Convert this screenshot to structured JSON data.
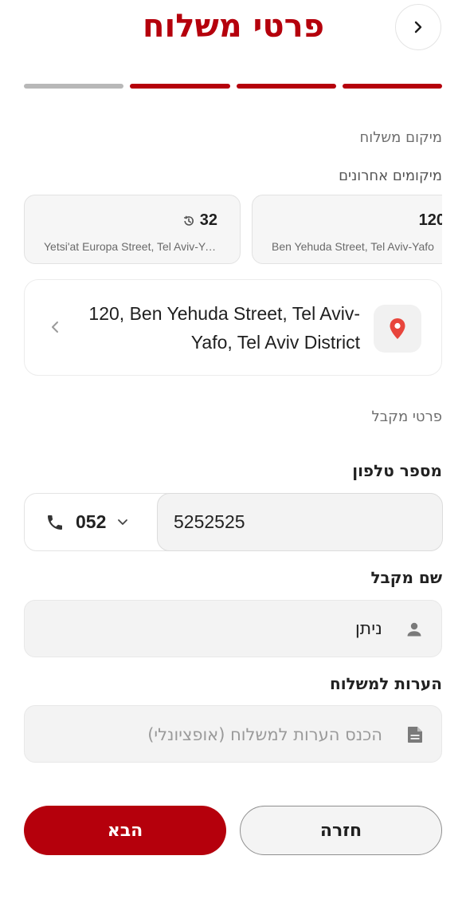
{
  "header": {
    "title": "פרטי משלוח",
    "back_icon": "chevron-right-icon"
  },
  "progress": {
    "total_steps": 4,
    "completed_steps": 3
  },
  "delivery_location": {
    "section_label": "מיקום משלוח",
    "recent_label": "מיקומים אחרונים",
    "recent": [
      {
        "number": "120",
        "address": "Ben Yehuda Street, Tel Aviv-Yafo"
      },
      {
        "number": "32",
        "address": "Yetsi'at Europa Street, Tel Aviv-Yafo",
        "icon": "history-icon"
      }
    ],
    "selected_address": "120, Ben Yehuda Street, Tel Aviv-Yafo, Tel Aviv District",
    "pin_icon": "map-pin-icon",
    "pin_color": "#e8453c"
  },
  "recipient": {
    "section_label": "פרטי מקבל",
    "phone_label": "מספר טלפון",
    "phone_prefix": "052",
    "phone_number": "5252525",
    "name_label": "שם מקבל",
    "name_value": "ניתן",
    "notes_label": "הערות למשלוח",
    "notes_placeholder": "הכנס הערות למשלוח (אופציונלי)"
  },
  "buttons": {
    "next_label": "הבא",
    "back_label": "חזרה"
  },
  "colors": {
    "brand": "#b5000c",
    "inactive_progress": "#b8b8b8"
  }
}
